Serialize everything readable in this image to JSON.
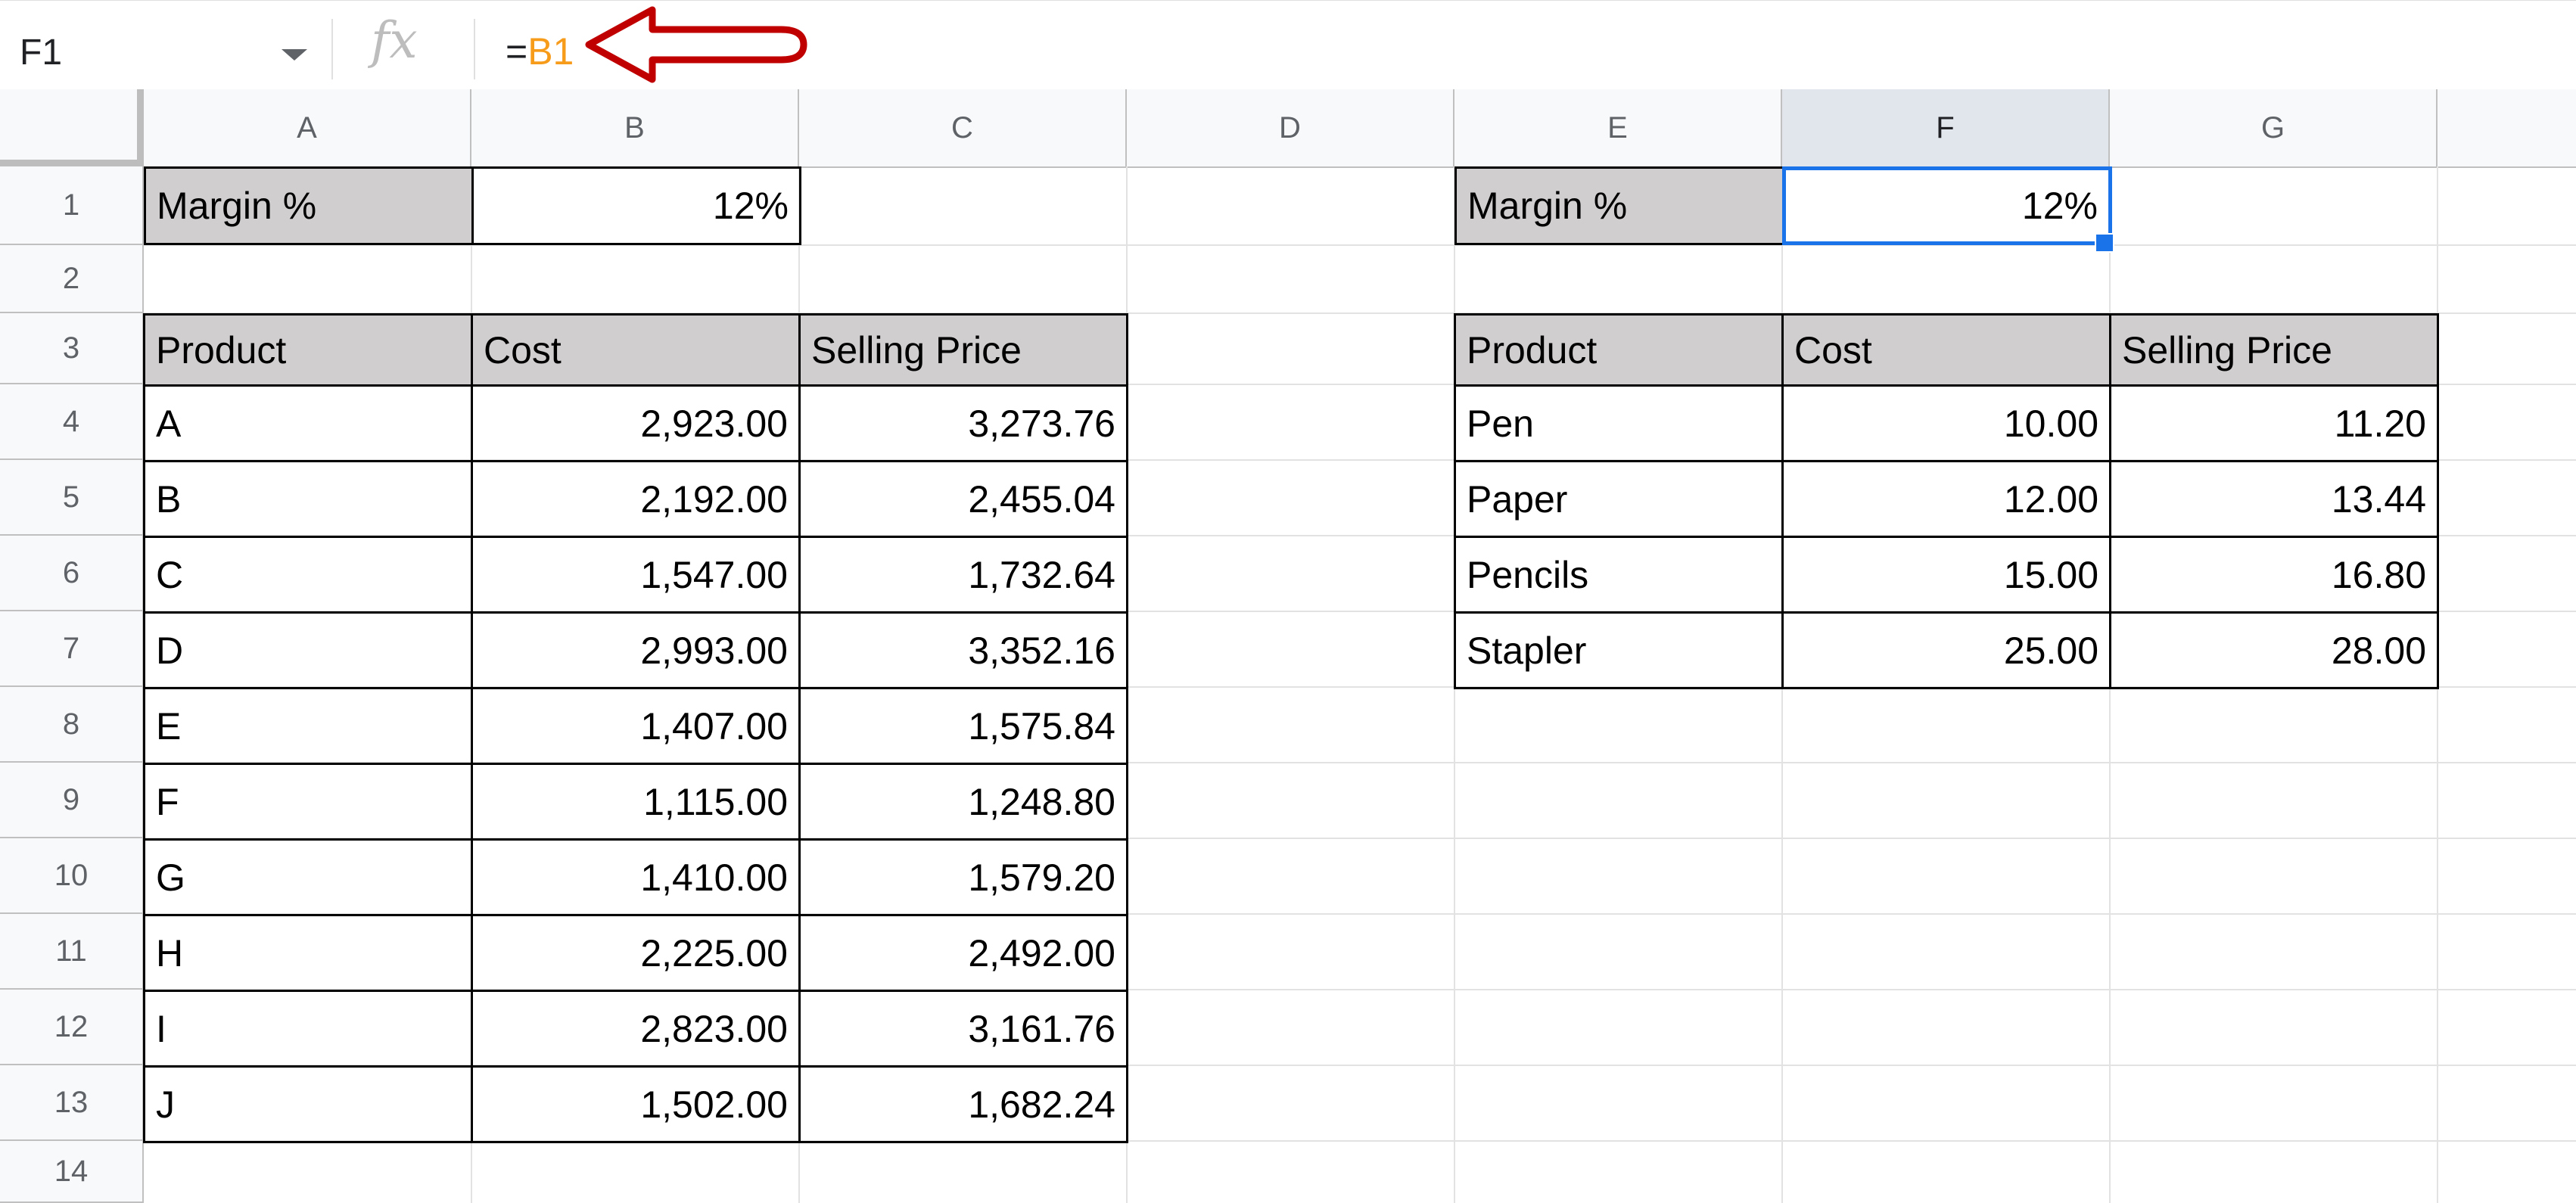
{
  "formula_bar": {
    "name_box": "F1",
    "fx_icon": "fx",
    "formula_prefix": "=",
    "formula_ref": "B1",
    "ref_color": "#f79b1b",
    "annotation": "red-left-arrow-icon"
  },
  "columns": [
    "A",
    "B",
    "C",
    "D",
    "E",
    "F",
    "G"
  ],
  "rows": [
    "1",
    "2",
    "3",
    "4",
    "5",
    "6",
    "7",
    "8",
    "9",
    "10",
    "11",
    "12",
    "13",
    "14"
  ],
  "left_table": {
    "margin_label": "Margin %",
    "margin_value": "12%",
    "headers": [
      "Product",
      "Cost",
      "Selling Price"
    ],
    "rows": [
      [
        "A",
        "2,923.00",
        "3,273.76"
      ],
      [
        "B",
        "2,192.00",
        "2,455.04"
      ],
      [
        "C",
        "1,547.00",
        "1,732.64"
      ],
      [
        "D",
        "2,993.00",
        "3,352.16"
      ],
      [
        "E",
        "1,407.00",
        "1,575.84"
      ],
      [
        "F",
        "1,115.00",
        "1,248.80"
      ],
      [
        "G",
        "1,410.00",
        "1,579.20"
      ],
      [
        "H",
        "2,225.00",
        "2,492.00"
      ],
      [
        "I",
        "2,823.00",
        "3,161.76"
      ],
      [
        "J",
        "1,502.00",
        "1,682.24"
      ]
    ]
  },
  "right_table": {
    "margin_label": "Margin %",
    "margin_value": "12%",
    "headers": [
      "Product",
      "Cost",
      "Selling Price"
    ],
    "rows": [
      [
        "Pen",
        "10.00",
        "11.20"
      ],
      [
        "Paper",
        "12.00",
        "13.44"
      ],
      [
        "Pencils",
        "15.00",
        "16.80"
      ],
      [
        "Stapler",
        "25.00",
        "28.00"
      ]
    ]
  },
  "colors": {
    "header_fill": "#d0cece",
    "selection": "#1a73e8",
    "arrow": "#c00000"
  }
}
